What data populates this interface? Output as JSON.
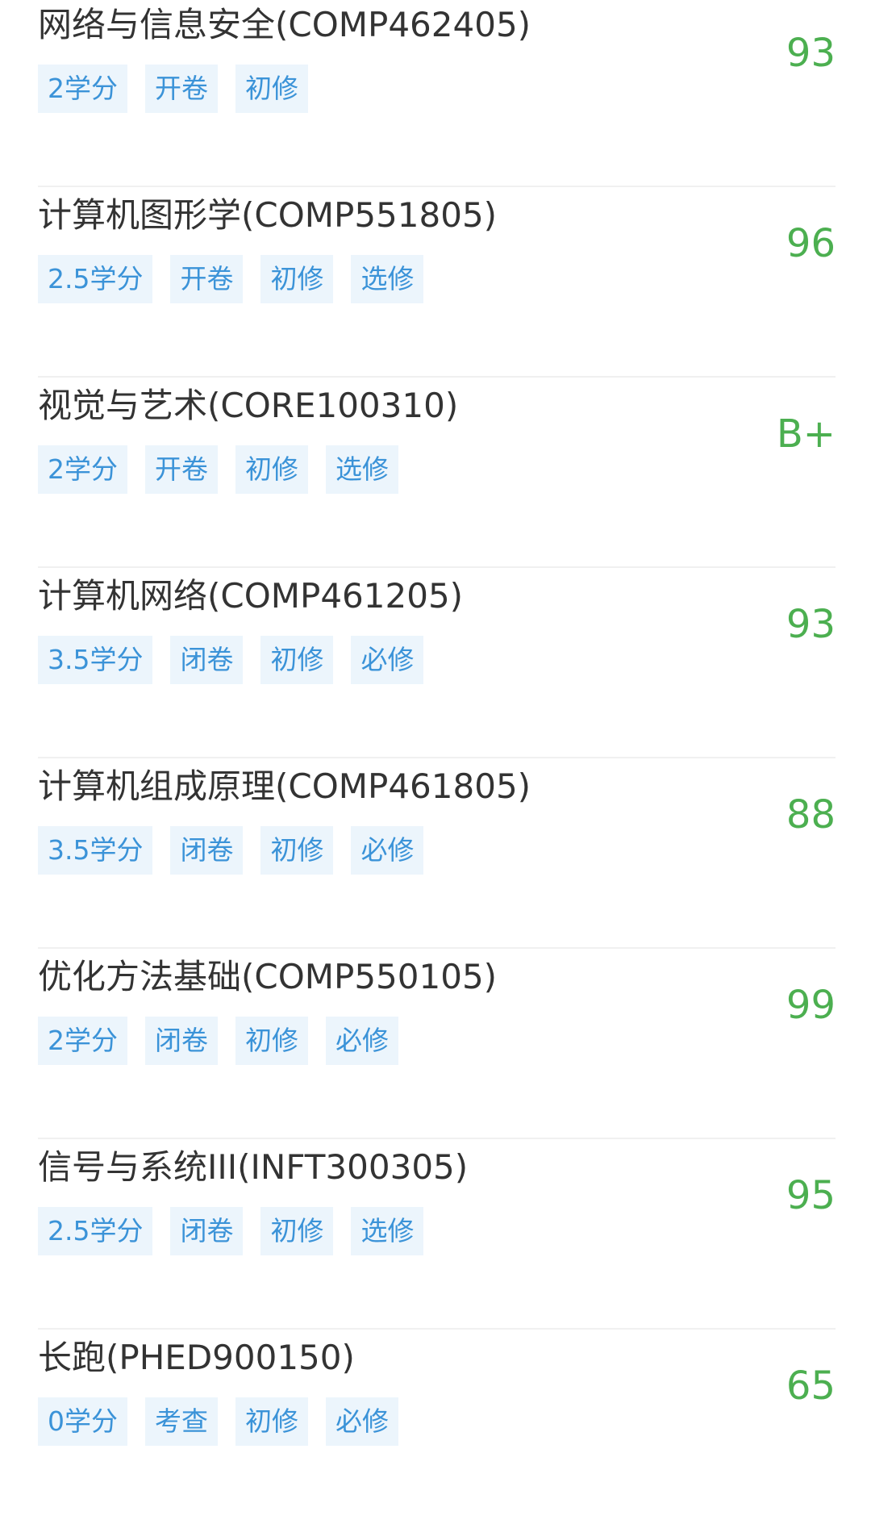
{
  "courses": [
    {
      "title": "网络与信息安全(COMP462405)",
      "tags": [
        "2学分",
        "开卷",
        "初修"
      ],
      "score": "93"
    },
    {
      "title": "计算机图形学(COMP551805)",
      "tags": [
        "2.5学分",
        "开卷",
        "初修",
        "选修"
      ],
      "score": "96"
    },
    {
      "title": "视觉与艺术(CORE100310)",
      "tags": [
        "2学分",
        "开卷",
        "初修",
        "选修"
      ],
      "score": "B+"
    },
    {
      "title": "计算机网络(COMP461205)",
      "tags": [
        "3.5学分",
        "闭卷",
        "初修",
        "必修"
      ],
      "score": "93"
    },
    {
      "title": "计算机组成原理(COMP461805)",
      "tags": [
        "3.5学分",
        "闭卷",
        "初修",
        "必修"
      ],
      "score": "88"
    },
    {
      "title": "优化方法基础(COMP550105)",
      "tags": [
        "2学分",
        "闭卷",
        "初修",
        "必修"
      ],
      "score": "99"
    },
    {
      "title": "信号与系统III(INFT300305)",
      "tags": [
        "2.5学分",
        "闭卷",
        "初修",
        "选修"
      ],
      "score": "95"
    },
    {
      "title": "长跑(PHED900150)",
      "tags": [
        "0学分",
        "考查",
        "初修",
        "必修"
      ],
      "score": "65"
    }
  ],
  "colors": {
    "score": "#4caf50",
    "tag_text": "#3b93d8",
    "tag_bg": "#ecf5fc",
    "title": "#333333",
    "divider": "#f0f0f0"
  }
}
